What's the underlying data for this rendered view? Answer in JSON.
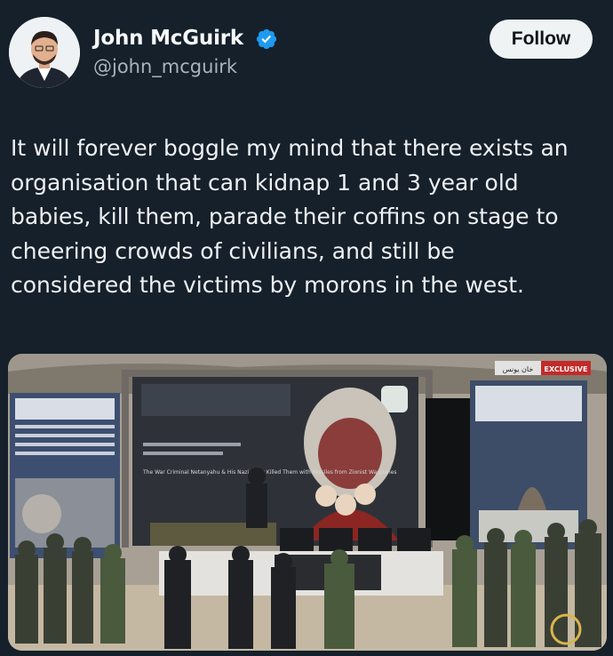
{
  "author": {
    "display_name": "John McGuirk",
    "handle": "@john_mcguirk",
    "verified": true,
    "verified_color": "#1d9bf0",
    "avatar_icon": "profile-photo"
  },
  "follow_button": {
    "label": "Follow"
  },
  "tweet": {
    "lines": [
      "It will forever boggle my mind that there exists an",
      "organisation that can kidnap 1 and 3 year old",
      "babies, kill them, parade their coffins on stage to",
      "cheering crowds of civilians, and still be",
      "considered the victims by morons in the west."
    ]
  },
  "media": {
    "badge_exclusive": "EXCLUSIVE",
    "badge_arabic": "خان يونس",
    "banner_english": "The War Criminal Netanyahu & His Nazi Army Killed Them with Missiles from Zionist Warplanes"
  },
  "colors": {
    "background": "#15202b",
    "text": "#e7e9ea",
    "secondary_text": "#a8b3bd",
    "button_bg": "#eff3f4"
  }
}
